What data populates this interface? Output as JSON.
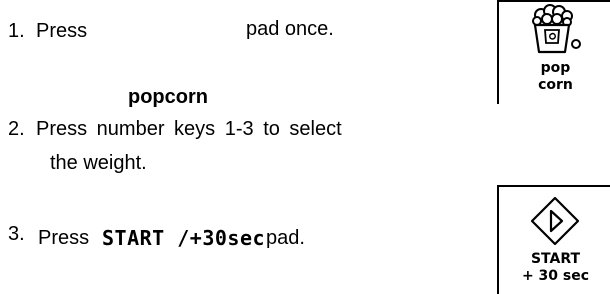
{
  "steps": [
    {
      "number": "1.",
      "press": "Press",
      "rest": "pad once.",
      "caption": "popcorn"
    },
    {
      "number": "2.",
      "line1": "Press number keys 1-3 to select",
      "line2": "the weight."
    },
    {
      "number": "3.",
      "press": "Press",
      "key": "START /+30sec",
      "rest": "pad."
    }
  ],
  "icons": {
    "popcorn": {
      "icon": "popcorn-bag-icon",
      "line1": "pop",
      "line2": "corn"
    },
    "start": {
      "icon": "diamond-play-icon",
      "line1": "START",
      "line2": "+ 30 sec"
    }
  }
}
